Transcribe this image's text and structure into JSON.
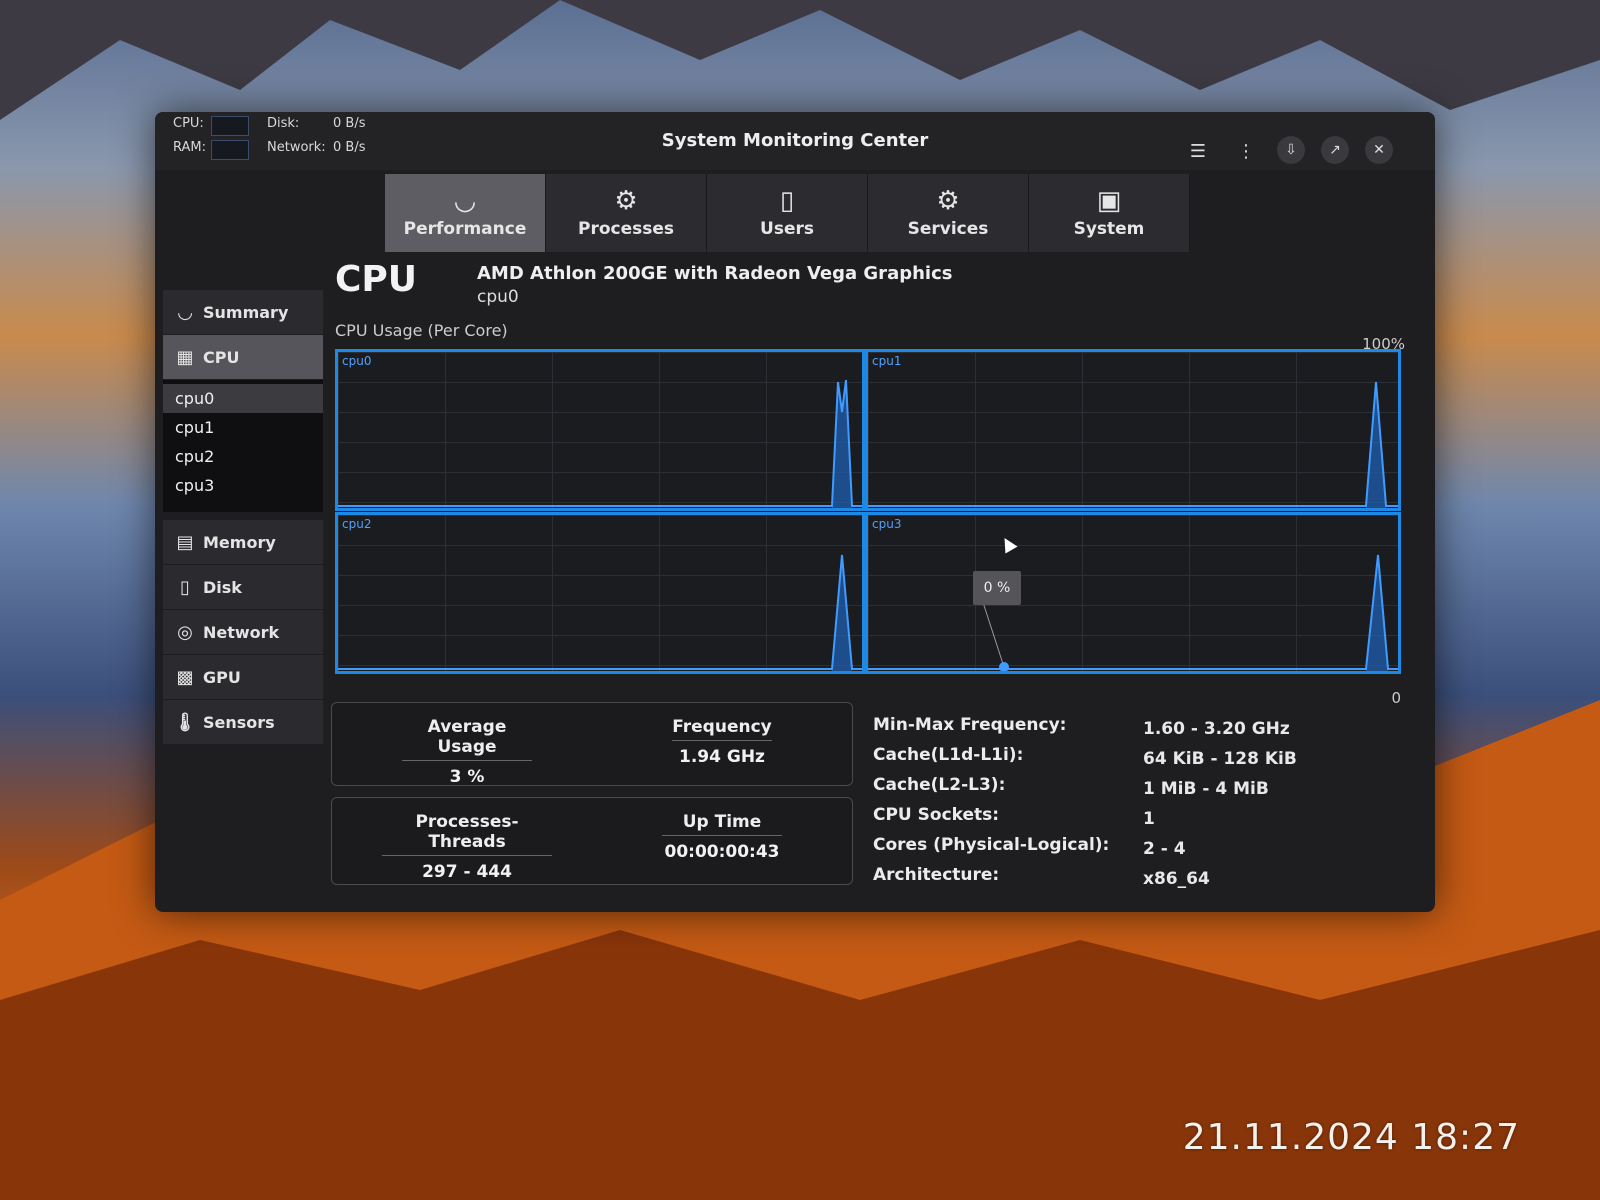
{
  "photo_timestamp": "21.11.2024 18:27",
  "titlebar": {
    "title": "System Monitoring Center",
    "cpu_label": "CPU:",
    "ram_label": "RAM:",
    "disk_label": "Disk:",
    "disk_value": "0 B/s",
    "network_label": "Network:",
    "network_value": "0 B/s",
    "icons": [
      "menu-icon",
      "more-vert-icon",
      "download-icon",
      "fullscreen-icon",
      "close-icon"
    ]
  },
  "tabs": [
    {
      "label": "Performance",
      "icon": "gauge-icon",
      "active": true
    },
    {
      "label": "Processes",
      "icon": "gear-icon",
      "active": false
    },
    {
      "label": "Users",
      "icon": "mouse-icon",
      "active": false
    },
    {
      "label": "Services",
      "icon": "gears-icon",
      "active": false
    },
    {
      "label": "System",
      "icon": "monitor-icon",
      "active": false
    }
  ],
  "sidebar": {
    "summary": "Summary",
    "cpu": "CPU",
    "cores": [
      "cpu0",
      "cpu1",
      "cpu2",
      "cpu3"
    ],
    "memory": "Memory",
    "disk": "Disk",
    "network": "Network",
    "gpu": "GPU",
    "sensors": "Sensors"
  },
  "cpu": {
    "title": "CPU",
    "model": "AMD Athlon 200GE with Radeon Vega Graphics",
    "selected_core": "cpu0",
    "graphs_label": "CPU Usage (Per Core)",
    "max_label": "100%",
    "min_label": "0",
    "tooltip": "0 %",
    "graphs": [
      {
        "label": "cpu0"
      },
      {
        "label": "cpu1"
      },
      {
        "label": "cpu2"
      },
      {
        "label": "cpu3"
      }
    ]
  },
  "stats": {
    "average_usage_label": "Average Usage",
    "average_usage": "3 %",
    "frequency_label": "Frequency",
    "frequency": "1.94 GHz",
    "processes_threads_label": "Processes-Threads",
    "processes_threads": "297 - 444",
    "uptime_label": "Up Time",
    "uptime": "00:00:00:43"
  },
  "info": [
    {
      "label": "Min-Max Frequency:",
      "value": "1.60 - 3.20 GHz"
    },
    {
      "label": "Cache(L1d-L1i):",
      "value": "64 KiB - 128 KiB"
    },
    {
      "label": "Cache(L2-L3):",
      "value": "1 MiB - 4 MiB"
    },
    {
      "label": "CPU Sockets:",
      "value": "1"
    },
    {
      "label": "Cores (Physical-Logical):",
      "value": "2 - 4"
    },
    {
      "label": "Architecture:",
      "value": "x86_64"
    }
  ]
}
